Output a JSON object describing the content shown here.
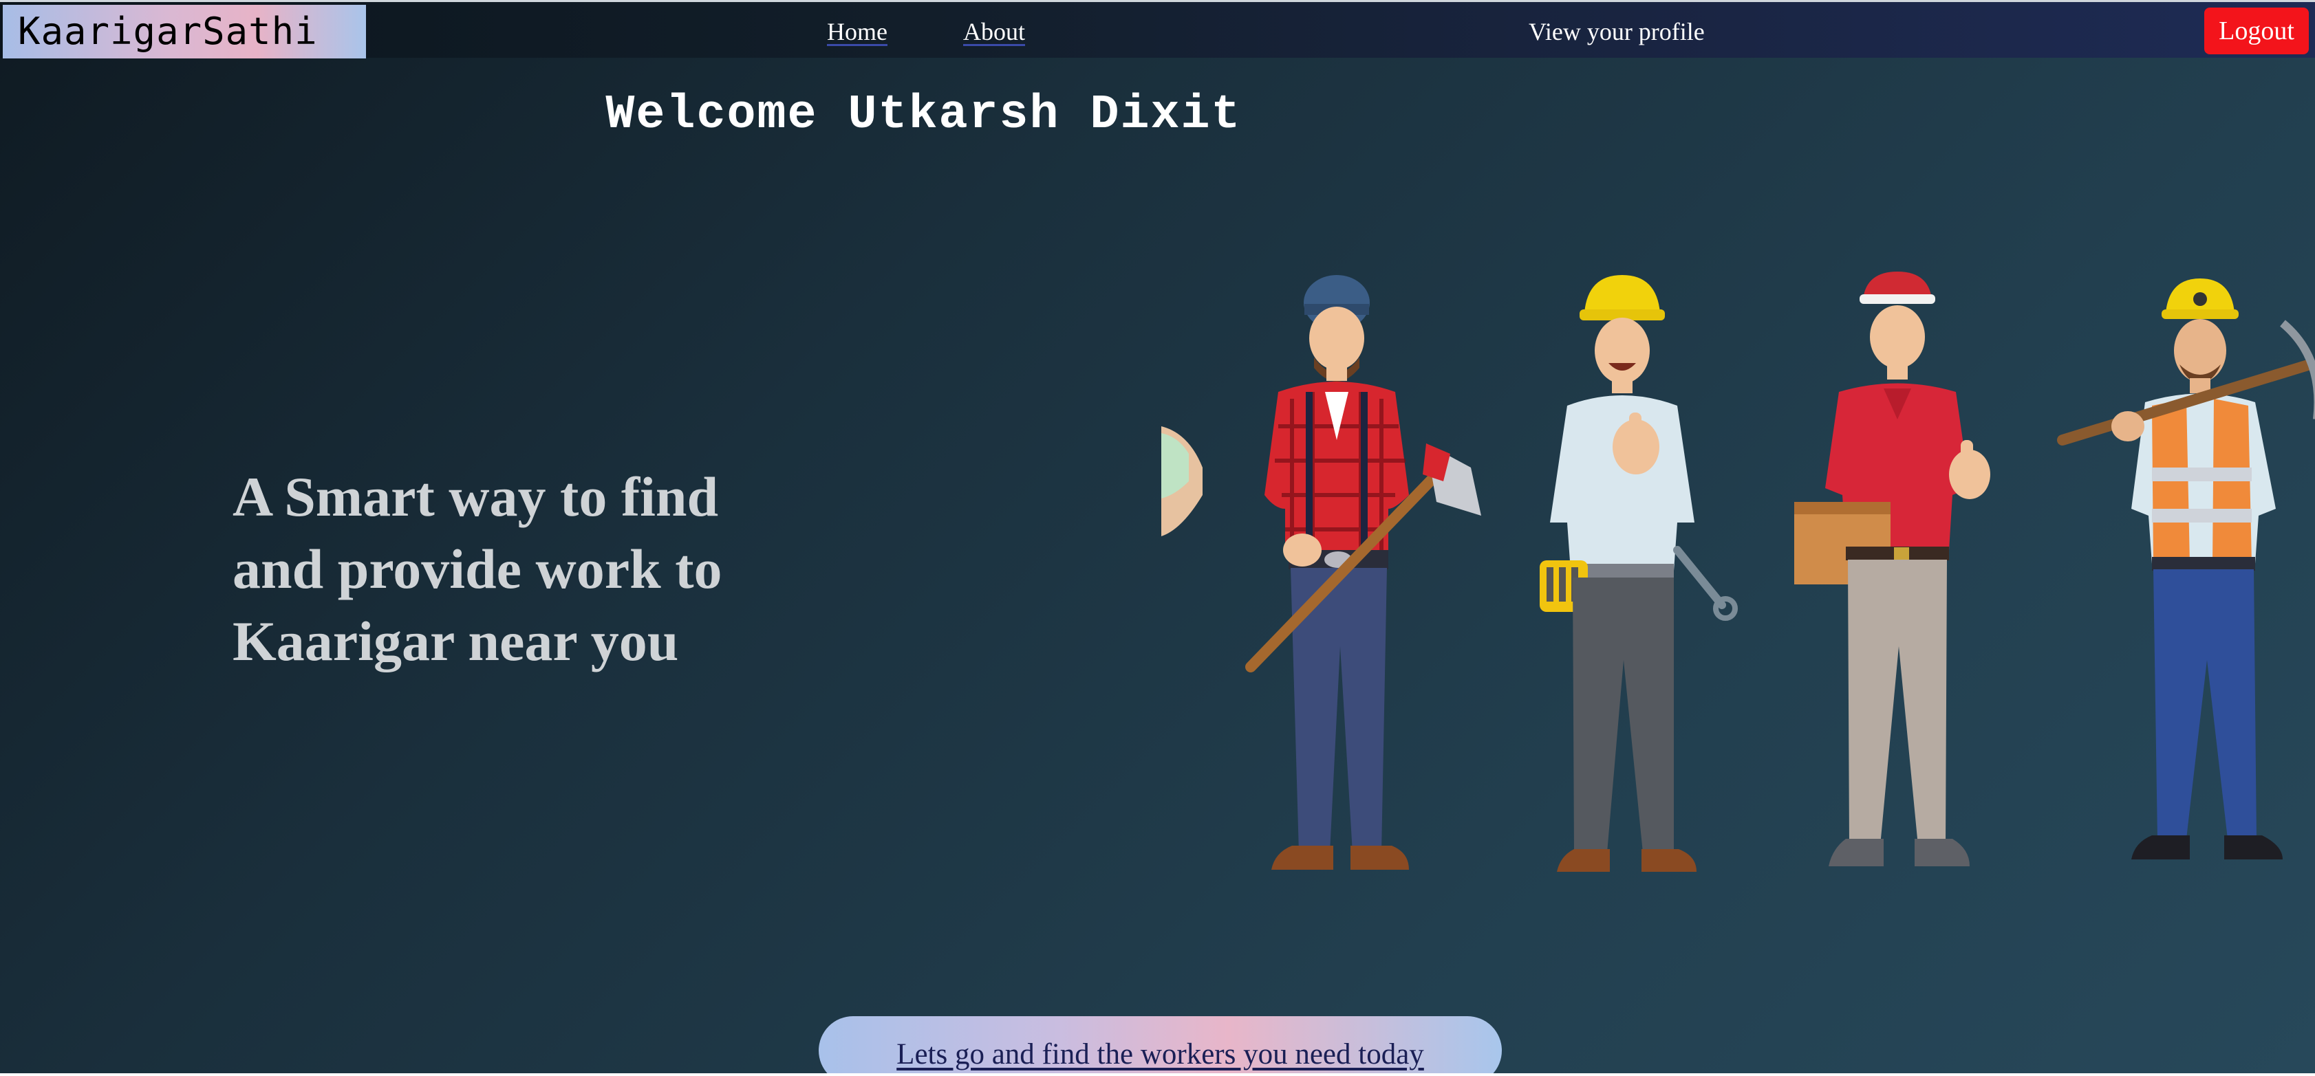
{
  "nav": {
    "brand": "KaarigarSathi",
    "home": "Home",
    "about": "About",
    "profile": "View your profile",
    "logout": "Logout"
  },
  "welcome": "Welcome Utkarsh Dixit",
  "tagline": "A Smart way to find and provide work to Kaarigar near you",
  "cta": "Lets go and find the workers you need today",
  "colors": {
    "logout_bg": "#f3141b",
    "brand_gradient_start": "#a7bde6",
    "brand_gradient_end": "#e7b3c7",
    "page_bg_dark": "#0f1a22",
    "page_bg_light": "#27485a"
  },
  "illustration": {
    "icon": "workers-group-illustration"
  }
}
